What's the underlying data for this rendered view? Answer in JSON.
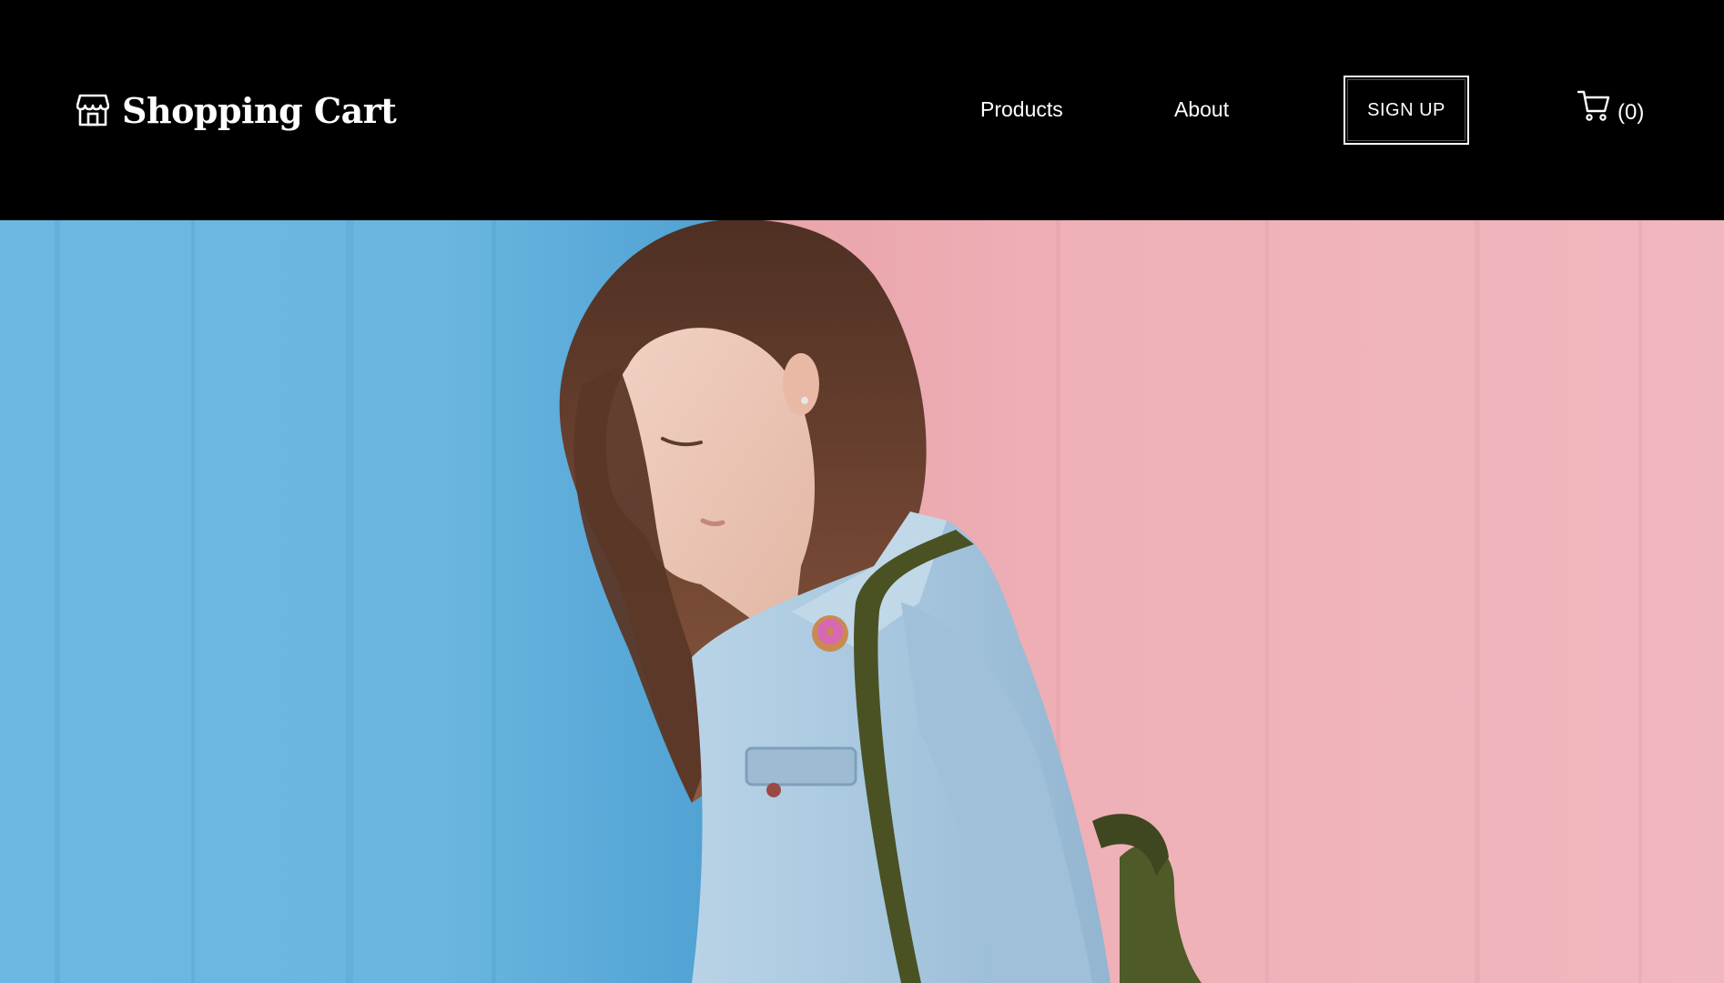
{
  "header": {
    "brand": {
      "icon": "storefront-icon",
      "title": "Shopping Cart"
    },
    "nav": {
      "products_label": "Products",
      "about_label": "About"
    },
    "signup_label": "SIGN UP",
    "cart": {
      "icon": "shopping-cart-icon",
      "count_label": "(0)"
    }
  },
  "hero": {
    "image": "woman-denim-jacket-blue-pink-wall",
    "colors": {
      "left_wall": "#6ab4df",
      "right_wall": "#efb2b9",
      "jacket": "#a9c9e0",
      "hair": "#6b4331",
      "strap": "#4a5224"
    }
  }
}
